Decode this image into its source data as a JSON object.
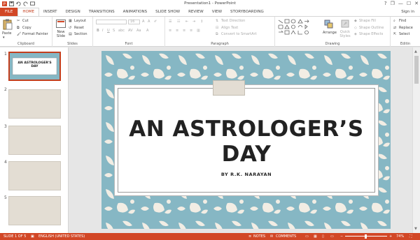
{
  "titlebar": {
    "title": "Presentation1 - PowerPoint",
    "help": "?",
    "restore": "❐",
    "minimize": "—",
    "maximize": "☐",
    "close": "✕"
  },
  "tabs": [
    "FILE",
    "HOME",
    "INSERT",
    "DESIGN",
    "TRANSITIONS",
    "ANIMATIONS",
    "SLIDE SHOW",
    "REVIEW",
    "VIEW",
    "STORYBOARDING"
  ],
  "active_tab": "HOME",
  "sign_in": "Sign in",
  "ribbon": {
    "clipboard": {
      "label": "Clipboard",
      "paste": "Paste",
      "cut": "Cut",
      "copy": "Copy",
      "format_painter": "Format Painter"
    },
    "slides": {
      "label": "Slides",
      "new_slide": "New Slide",
      "layout": "Layout",
      "reset": "Reset",
      "section": "Section"
    },
    "font": {
      "label": "Font",
      "size_value": "16"
    },
    "paragraph": {
      "label": "Paragraph",
      "text_direction": "Text Direction",
      "align_text": "Align Text",
      "smartart": "Convert to SmartArt"
    },
    "drawing": {
      "label": "Drawing",
      "arrange": "Arrange",
      "quick_styles": "Quick Styles",
      "shape_fill": "Shape Fill",
      "shape_outline": "Shape Outline",
      "shape_effects": "Shape Effects"
    },
    "editing": {
      "label": "Editin",
      "find": "Find",
      "replace": "Replace",
      "select": "Select"
    }
  },
  "thumbnails": [
    {
      "num": "1",
      "title": "AN ASTROLOGER'S DAY"
    },
    {
      "num": "2"
    },
    {
      "num": "3"
    },
    {
      "num": "4"
    },
    {
      "num": "5"
    }
  ],
  "slide": {
    "title_line1": "AN ASTROLOGER’S",
    "title_line2": "DAY",
    "subtitle": "BY R.K. NARAYAN"
  },
  "status": {
    "slide_info": "SLIDE 1 OF 5",
    "language": "ENGLISH (UNITED STATES)",
    "notes": "NOTES",
    "comments": "COMMENTS",
    "zoom": "74%"
  },
  "colors": {
    "accent": "#d24726",
    "slide_bg": "#86b7c4",
    "leaf": "#f2ede4",
    "tab_deco": "#e3ddd3"
  }
}
